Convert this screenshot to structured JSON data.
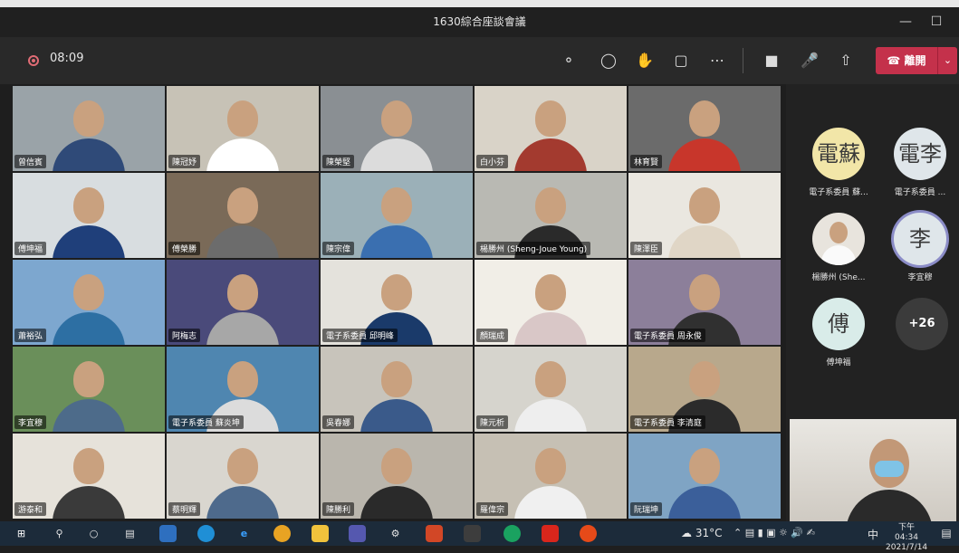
{
  "window": {
    "title": "1630綜合座談會議"
  },
  "toolbar": {
    "timer": "08:09",
    "leave_label": "離開"
  },
  "participants": [
    {
      "name": "曾信賓"
    },
    {
      "name": "陳冠妤"
    },
    {
      "name": "陳榮堅"
    },
    {
      "name": "白小芬"
    },
    {
      "name": "林育賢"
    },
    {
      "name": "傅坤福"
    },
    {
      "name": "傅榮勝"
    },
    {
      "name": "陳宗偉"
    },
    {
      "name": "楊勝州 (Sheng-Joue Young)"
    },
    {
      "name": "陳澤臣"
    },
    {
      "name": "蕭裕弘"
    },
    {
      "name": "阿梅志"
    },
    {
      "name": "電子系委員 邱明峰"
    },
    {
      "name": "顏瑞成"
    },
    {
      "name": "電子系委員 周永俊"
    },
    {
      "name": "李宜穆"
    },
    {
      "name": "電子系委員 蘇炎坤"
    },
    {
      "name": "吳春娜"
    },
    {
      "name": "陳元析"
    },
    {
      "name": "電子系委員 李清庭"
    },
    {
      "name": "游泰和"
    },
    {
      "name": "蔡明輝"
    },
    {
      "name": "陳勝利"
    },
    {
      "name": "羅偉宗"
    },
    {
      "name": "阮瑞坤"
    }
  ],
  "side_panel": {
    "people": [
      {
        "initials": "電蘇",
        "label": "電子系委員 蘇...",
        "color": "#f2e6a8"
      },
      {
        "initials": "電李",
        "label": "電子系委員 ...",
        "color": "#dfe6ea"
      },
      {
        "initials": "",
        "label": "楊勝州 (She...",
        "color": "#e8e4dd"
      },
      {
        "initials": "李",
        "label": "李宜穆",
        "color": "#dfe6ea"
      },
      {
        "initials": "傅",
        "label": "傅坤福",
        "color": "#d9ece9"
      }
    ],
    "more_count": "+26"
  },
  "taskbar": {
    "weather": "31°C",
    "ime": "中",
    "time": "下午 04:34",
    "date": "2021/7/14"
  }
}
